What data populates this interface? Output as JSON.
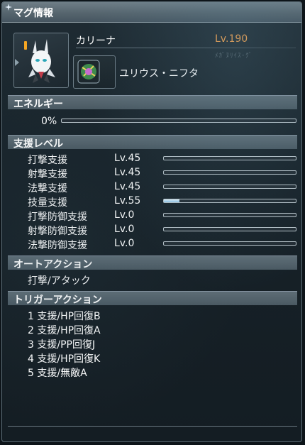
{
  "window": {
    "title": "マグ情報"
  },
  "mag": {
    "name": "カリーナ",
    "level": "Lv.190",
    "photon_blast": "ユリウス・ニフタ",
    "faded_text": "ﾒｶﾞﾇﾘｲｽ･ｸﾞ"
  },
  "energy": {
    "header": "エネルギー",
    "percent_label": "0%",
    "fraction": 0.0
  },
  "support": {
    "header": "支援レベル",
    "rows": [
      {
        "label": "打撃支援",
        "level": "Lv.45",
        "fraction": 0.0
      },
      {
        "label": "射撃支援",
        "level": "Lv.45",
        "fraction": 0.0
      },
      {
        "label": "法撃支援",
        "level": "Lv.45",
        "fraction": 0.0
      },
      {
        "label": "技量支援",
        "level": "Lv.55",
        "fraction": 0.12
      },
      {
        "label": "打撃防御支援",
        "level": "Lv.0",
        "fraction": 0.0
      },
      {
        "label": "射撃防御支援",
        "level": "Lv.0",
        "fraction": 0.0
      },
      {
        "label": "法撃防御支援",
        "level": "Lv.0",
        "fraction": 0.0
      }
    ]
  },
  "auto_action": {
    "header": "オートアクション",
    "value": "打撃/アタック"
  },
  "trigger_action": {
    "header": "トリガーアクション",
    "items": [
      "1 支援/HP回復B",
      "2 支援/HP回復A",
      "3 支援/PP回復J",
      "4 支援/HP回復K",
      "5 支援/無敵A"
    ]
  },
  "colors": {
    "level_accent": "#f5a04a",
    "marker": "#f5a623",
    "bar_fill": "#8ec8ee"
  }
}
